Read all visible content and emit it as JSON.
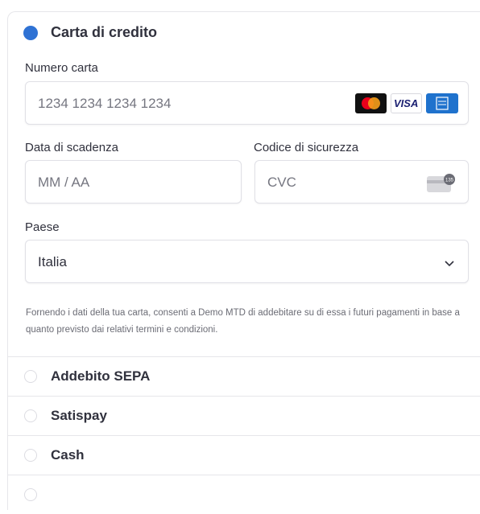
{
  "selected_method": {
    "label": "Carta di credito",
    "card_number": {
      "label": "Numero carta",
      "placeholder": "1234 1234 1234 1234"
    },
    "card_brands": [
      "mastercard-icon",
      "visa-icon",
      "amex-icon"
    ],
    "visa_text": "VISA",
    "expiry": {
      "label": "Data di scadenza",
      "placeholder": "MM / AA"
    },
    "cvc": {
      "label": "Codice di sicurezza",
      "placeholder": "CVC"
    },
    "country": {
      "label": "Paese",
      "value": "Italia"
    },
    "disclaimer": "Fornendo i dati della tua carta, consenti a Demo MTD di addebitare su di essa i futuri pagamenti in base a quanto previsto dai relativi termini e condizioni."
  },
  "other_methods": [
    {
      "label": "Addebito SEPA"
    },
    {
      "label": "Satispay"
    },
    {
      "label": "Cash"
    }
  ],
  "colors": {
    "accent": "#2f72d4",
    "text": "#30313d",
    "muted": "#6b6c75",
    "border": "#e0e0e6"
  }
}
